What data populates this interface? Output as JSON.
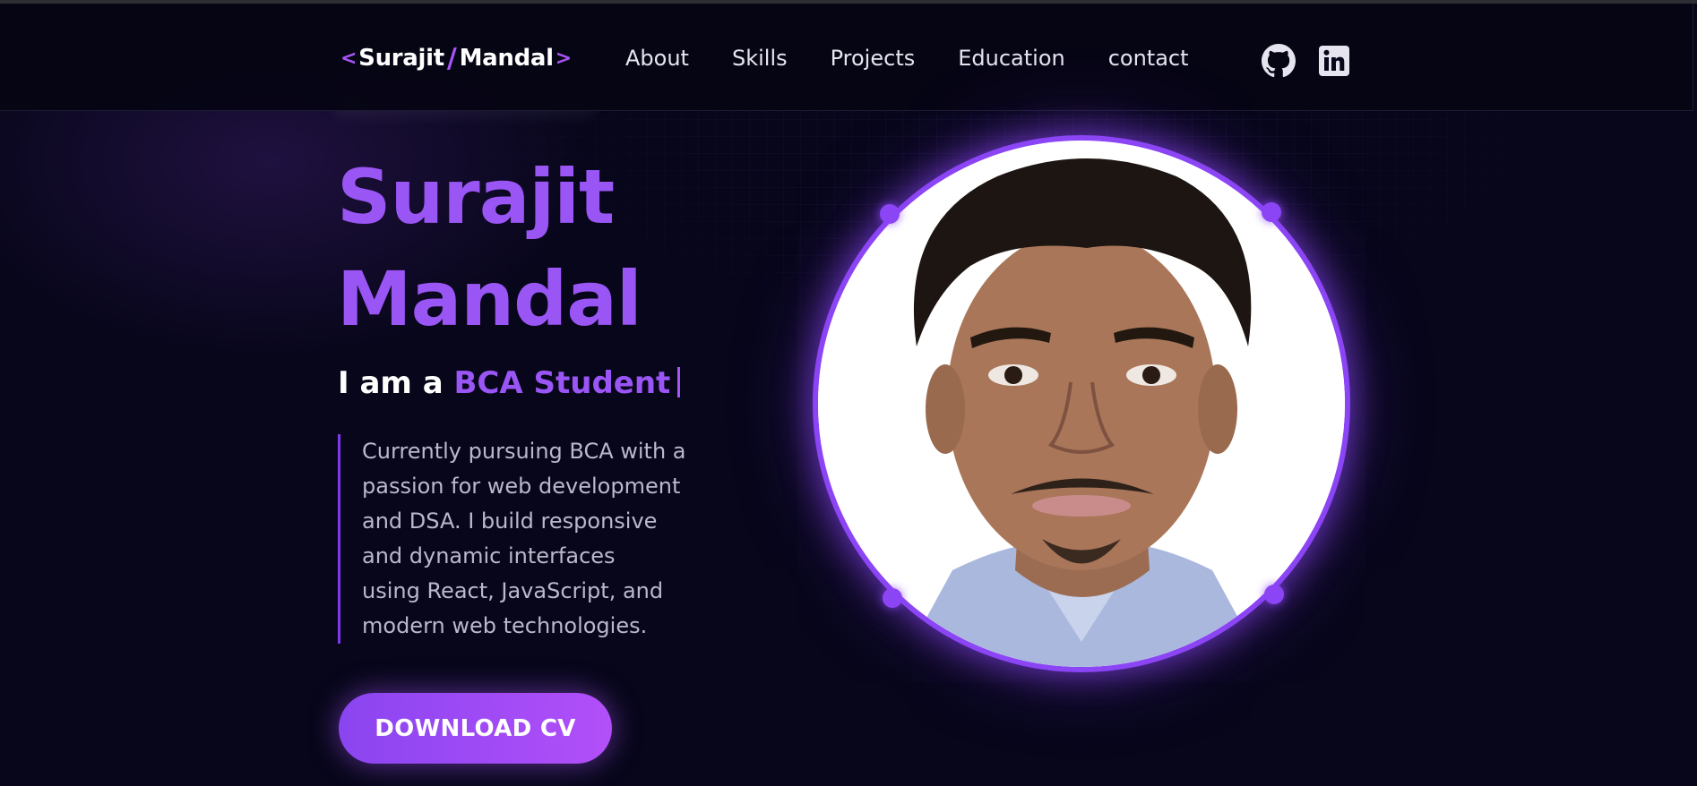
{
  "logo": {
    "open": "<",
    "first": "Surajit",
    "slash": "/",
    "last": "Mandal",
    "close": ">"
  },
  "nav": {
    "links": [
      "About",
      "Skills",
      "Projects",
      "Education",
      "contact"
    ],
    "social": [
      {
        "name": "github-icon"
      },
      {
        "name": "linkedin-icon"
      }
    ]
  },
  "hero": {
    "name_line1": "Surajit",
    "name_line2": "Mandal",
    "role_prefix": "I am a",
    "role_accent": "BCA Student",
    "description": "Currently pursuing BCA with a\npassion for web development\nand DSA. I build responsive\nand dynamic interfaces\nusing React, JavaScript, and\nmodern web technologies.",
    "cv_button": "DOWNLOAD CV"
  },
  "colors": {
    "background": "#07061a",
    "accent": "#9a55f5",
    "text": "#ffffff",
    "muted": "#bcb8cc"
  }
}
